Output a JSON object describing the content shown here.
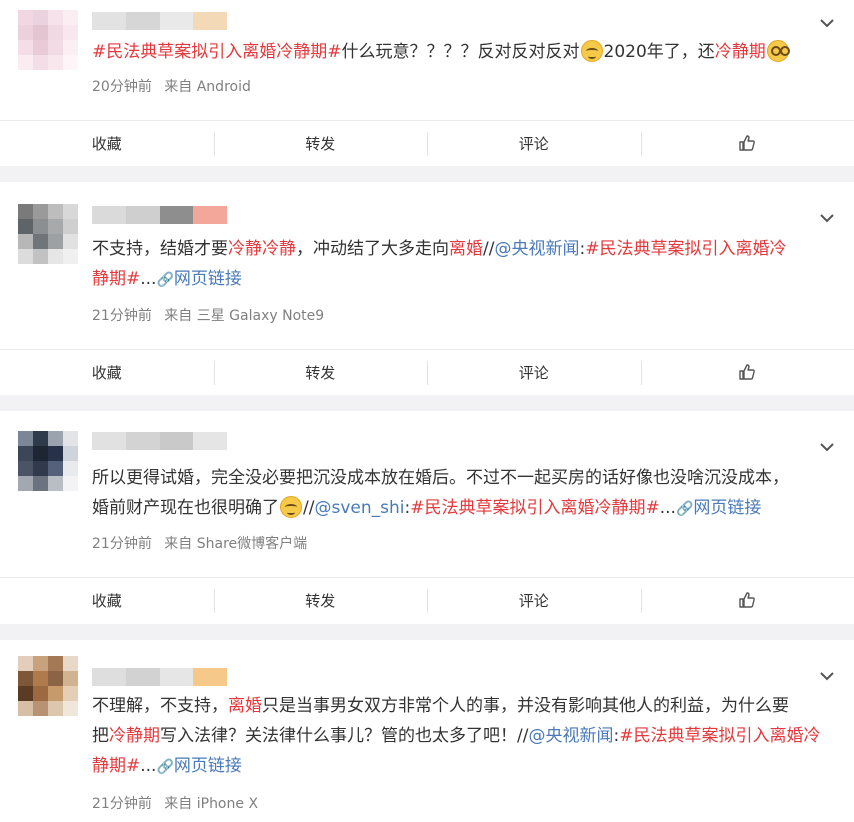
{
  "posts": [
    {
      "segments": [
        [
          {
            "t": "#民法典草案拟引入离婚冷静期#",
            "c": "tag"
          },
          {
            "t": "什么玩意？？？？反对反对反对",
            "c": ""
          },
          {
            "emoji": "smirk"
          },
          {
            "t": "2020年了，还",
            "c": ""
          },
          {
            "t": "冷静期",
            "c": "kw"
          },
          {
            "emoji": "dizzy"
          }
        ]
      ],
      "time": "20分钟前",
      "source": "来自 Android"
    },
    {
      "segments": [
        [
          {
            "t": "不支持，结婚才要",
            "c": ""
          },
          {
            "t": "冷静冷静",
            "c": "kw"
          },
          {
            "t": "，冲动结了大多走向",
            "c": ""
          },
          {
            "t": "离婚",
            "c": "kw"
          },
          {
            "t": "//",
            "c": ""
          },
          {
            "t": "@央视新闻",
            "c": "mention"
          },
          {
            "t": ":",
            "c": ""
          },
          {
            "t": "#民法典草案拟引入离婚冷",
            "c": "tag"
          }
        ],
        [
          {
            "t": "静期#",
            "c": "tag"
          },
          {
            "t": "...",
            "c": ""
          },
          {
            "icon": "link"
          },
          {
            "t": "网页链接",
            "c": "lnk"
          }
        ]
      ],
      "time": "21分钟前",
      "source": "来自 三星 Galaxy Note9"
    },
    {
      "segments": [
        [
          {
            "t": "所以更得试婚，完全没必要把沉没成本放在婚后。不过不一起买房的话好像也没啥沉没成本，",
            "c": ""
          }
        ],
        [
          {
            "t": "婚前财产现在也很明确了",
            "c": ""
          },
          {
            "emoji": "smirk"
          },
          {
            "t": "//",
            "c": ""
          },
          {
            "t": "@sven_shi",
            "c": "mention"
          },
          {
            "t": ":",
            "c": ""
          },
          {
            "t": "#民法典草案拟引入离婚冷静期#",
            "c": "tag"
          },
          {
            "t": "...",
            "c": ""
          },
          {
            "icon": "link"
          },
          {
            "t": "网页链接",
            "c": "lnk"
          }
        ]
      ],
      "time": "21分钟前",
      "source": "来自 Share微博客户端"
    },
    {
      "segments": [
        [
          {
            "t": "不理解，不支持，",
            "c": ""
          },
          {
            "t": "离婚",
            "c": "kw"
          },
          {
            "t": "只是当事男女双方非常个人的事，并没有影响其他人的利益，为什么要",
            "c": ""
          }
        ],
        [
          {
            "t": "把",
            "c": ""
          },
          {
            "t": "冷静期",
            "c": "kw"
          },
          {
            "t": "写入法律？关法律什么事儿？管的也太多了吧！//",
            "c": ""
          },
          {
            "t": "@央视新闻",
            "c": "mention"
          },
          {
            "t": ":",
            "c": ""
          },
          {
            "t": "#民法典草案拟引入离婚冷",
            "c": "tag"
          }
        ],
        [
          {
            "t": "静期#",
            "c": "tag"
          },
          {
            "t": "...",
            "c": ""
          },
          {
            "icon": "link"
          },
          {
            "t": "网页链接",
            "c": "lnk"
          }
        ]
      ],
      "time": "21分钟前",
      "source": "来自 iPhone X"
    }
  ],
  "actions": {
    "collect": "收藏",
    "repost": "转发",
    "comment": "评论"
  },
  "colors": {
    "tag": "#e4393c",
    "mention": "#4a7ab8",
    "meta": "#808080"
  }
}
